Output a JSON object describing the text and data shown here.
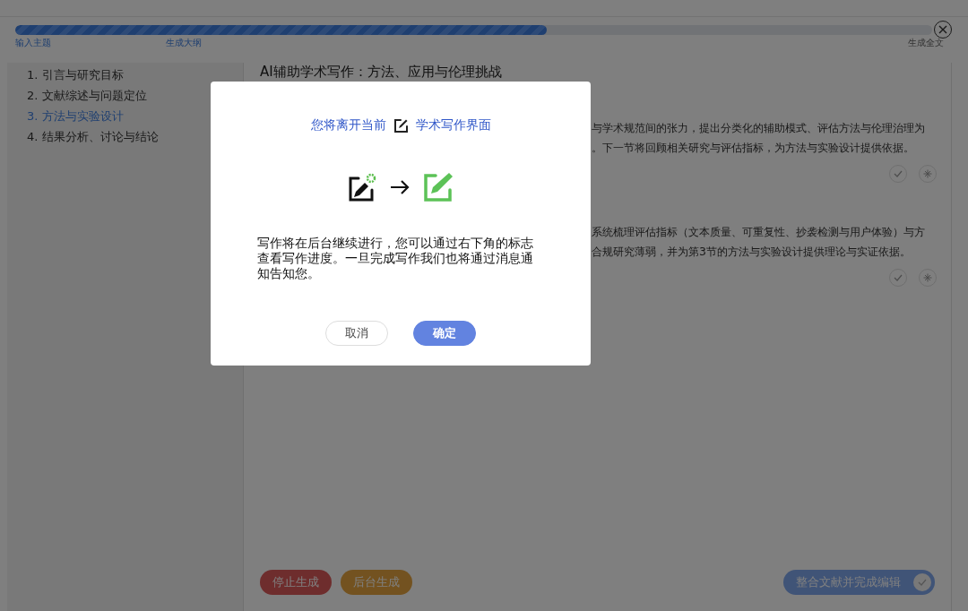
{
  "progress": {
    "level": 0.58,
    "steps": [
      {
        "label": "输入主题",
        "done": true
      },
      {
        "label": "生成大纲",
        "done": true
      },
      {
        "label": "生成全文",
        "done": false
      }
    ]
  },
  "outline": {
    "items": [
      {
        "label": "1. 引言与研究目标",
        "selected": false
      },
      {
        "label": "2. 文献综述与问题定位",
        "selected": false
      },
      {
        "label": "3. 方法与实验设计",
        "selected": true
      },
      {
        "label": "4. 结果分析、讨论与结论",
        "selected": false
      }
    ]
  },
  "document": {
    "title": "AI辅助学术写作：方法、应用与伦理挑战",
    "sections": [
      {
        "lines": [
          "与学术规范间的张力，提出分类化的辅助模式、评估方法与伦理治理为",
          "。下一节将回顾相关研究与评估指标，为方法与实验设计提供依据。"
        ]
      },
      {
        "lines": [
          "系统梳理评估指标（文本质量、可重复性、抄袭检测与用户体验）与方",
          "合规研究薄弱，并为第3节的方法与实验设计提供理论与实证依据。"
        ]
      }
    ]
  },
  "actions": [
    {
      "label": "停止生成",
      "kind": "stop"
    },
    {
      "label": "后台生成",
      "kind": "background"
    },
    {
      "label": "整合文献并完成编辑",
      "kind": "finish"
    }
  ],
  "dialog": {
    "title_before": "您将离开当前",
    "title_after": "学术写作界面",
    "message": "写作将在后台继续进行，您可以通过右下角的标志查看写作进度。一旦完成写作我们也将通过消息通知告知您。",
    "buttons": [
      {
        "label": "取消",
        "kind": "secondary"
      },
      {
        "label": "确定",
        "kind": "primary"
      }
    ]
  }
}
